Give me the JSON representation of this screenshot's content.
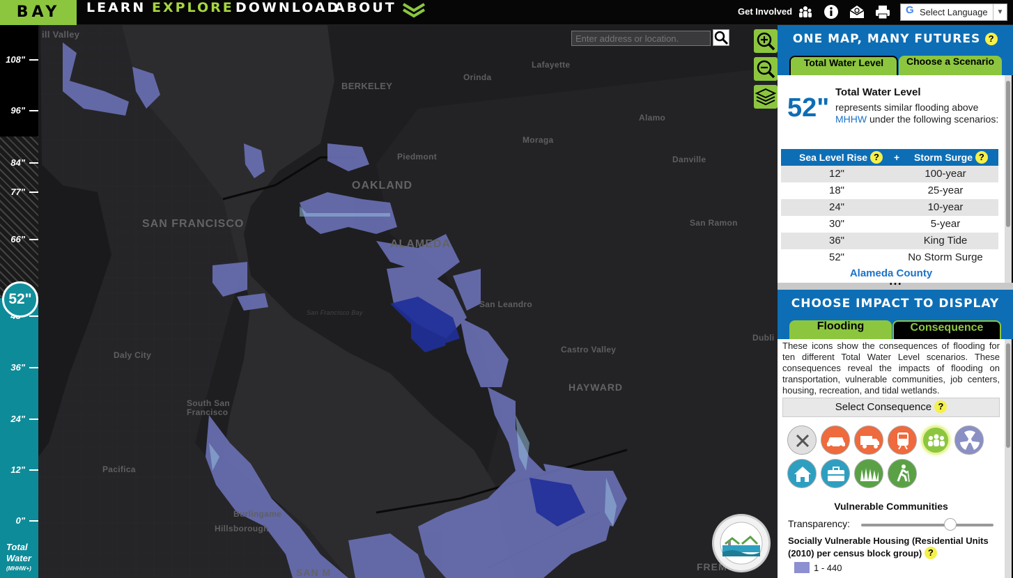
{
  "nav": {
    "logo": "BAY",
    "items": [
      "LEARN",
      "EXPLORE",
      "DOWNLOAD",
      "ABOUT"
    ],
    "active": "EXPLORE",
    "get_involved": "Get Involved",
    "language": "Select Language",
    "accent": "#8cc63f"
  },
  "search": {
    "placeholder": "Enter address or location."
  },
  "map": {
    "labels": {
      "mill_valley": "ill Valley",
      "berkeley": "BERKELEY",
      "orinda": "Orinda",
      "lafayette": "Lafayette",
      "alamo": "Alamo",
      "moraga": "Moraga",
      "piedmont": "Piedmont",
      "danville": "Danville",
      "oakland": "OAKLAND",
      "san_francisco": "SAN FRANCISCO",
      "alameda": "ALAMEDA",
      "san_ramon": "San Ramon",
      "sf_bay": "San Francisco Bay",
      "san_leandro": "San Leandro",
      "daly_city": "Daly City",
      "castro_valley": "Castro Valley",
      "hayward": "HAYWARD",
      "south_sf": "South San Francisco",
      "pacifica": "Pacifica",
      "burlingame": "Burlingame",
      "hillsborough": "Hillsborough",
      "san_mateo": "SAN M",
      "fremont": "FREMO",
      "dublin": "Dubli"
    }
  },
  "gauge": {
    "ticks": [
      "108\"",
      "96\"",
      "84\"",
      "77\"",
      "66\"",
      "48\"",
      "36\"",
      "24\"",
      "12\"",
      "0\""
    ],
    "value": "52\"",
    "label": "Total Water",
    "sublabel": "(MHHW+)"
  },
  "panel": {
    "header1": "ONE MAP, MANY FUTURES",
    "tab_total": "Total Water Level",
    "tab_scenario": "Choose a Scenario",
    "big_value": "52\"",
    "title": "Total Water Level",
    "desc_a": "represents similar flooding above ",
    "desc_link": "MHHW",
    "desc_b": " under the following scenarios:",
    "col_slr": "Sea Level Rise",
    "plus": "+",
    "col_storm": "Storm Surge",
    "rows": [
      [
        "12\"",
        "100-year"
      ],
      [
        "18\"",
        "25-year"
      ],
      [
        "24\"",
        "10-year"
      ],
      [
        "30\"",
        "5-year"
      ],
      [
        "36\"",
        "King Tide"
      ],
      [
        "52\"",
        "No Storm Surge"
      ]
    ],
    "county": "Alameda County",
    "divider": "• • •",
    "header2": "CHOOSE IMPACT TO DISPLAY",
    "tab_flooding": "Flooding",
    "tab_consequence": "Consequence",
    "cons_desc": "These icons show the consequences of flooding for ten different Total Water Level scenarios. These consequences reveal the impacts of flooding on transportation, vulnerable communities, job centers, housing, recreation, and tidal wetlands.",
    "select": "Select Consequence",
    "selected": "Vulnerable Communities",
    "transparency": "Transparency:",
    "transparency_level": 0.8,
    "legend_title": "Socially Vulnerable Housing (Residential Units (2010) per census block group)",
    "legend_range": "1 - 440"
  }
}
